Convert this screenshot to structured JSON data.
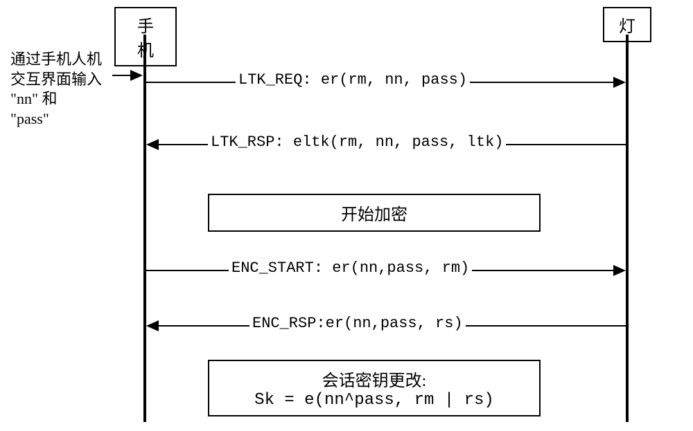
{
  "participants": {
    "phone": "手机",
    "lamp": "灯"
  },
  "side_note": {
    "line1": "通过手机人机",
    "line2": "交互界面输入",
    "line3": "\"nn\" 和",
    "line4": "\"pass\""
  },
  "messages": {
    "ltk_req": "LTK_REQ: er(rm, nn, pass)",
    "ltk_rsp": "LTK_RSP: eltk(rm, nn, pass, ltk)",
    "enc_start": "ENC_START: er(nn,pass, rm)",
    "enc_rsp": "ENC_RSP:er(nn,pass, rs)"
  },
  "notes": {
    "start_encrypt": "开始加密",
    "session_key_title": "会话密钥更改:",
    "session_key_formula": "Sk = e(nn^pass, rm | rs)"
  },
  "chart_data": {
    "type": "sequence-diagram",
    "participants": [
      "手机",
      "灯"
    ],
    "events": [
      {
        "type": "found-message",
        "to": "手机",
        "label": "通过手机人机交互界面输入 \"nn\" 和 \"pass\""
      },
      {
        "type": "message",
        "from": "手机",
        "to": "灯",
        "label": "LTK_REQ: er(rm, nn, pass)"
      },
      {
        "type": "message",
        "from": "灯",
        "to": "手机",
        "label": "LTK_RSP: eltk(rm, nn, pass, ltk)"
      },
      {
        "type": "note",
        "over": [
          "手机",
          "灯"
        ],
        "text": "开始加密"
      },
      {
        "type": "message",
        "from": "手机",
        "to": "灯",
        "label": "ENC_START: er(nn,pass, rm)"
      },
      {
        "type": "message",
        "from": "灯",
        "to": "手机",
        "label": "ENC_RSP:er(nn,pass, rs)"
      },
      {
        "type": "note",
        "over": [
          "手机",
          "灯"
        ],
        "text": "会话密钥更改: Sk = e(nn^pass, rm | rs)"
      }
    ]
  }
}
